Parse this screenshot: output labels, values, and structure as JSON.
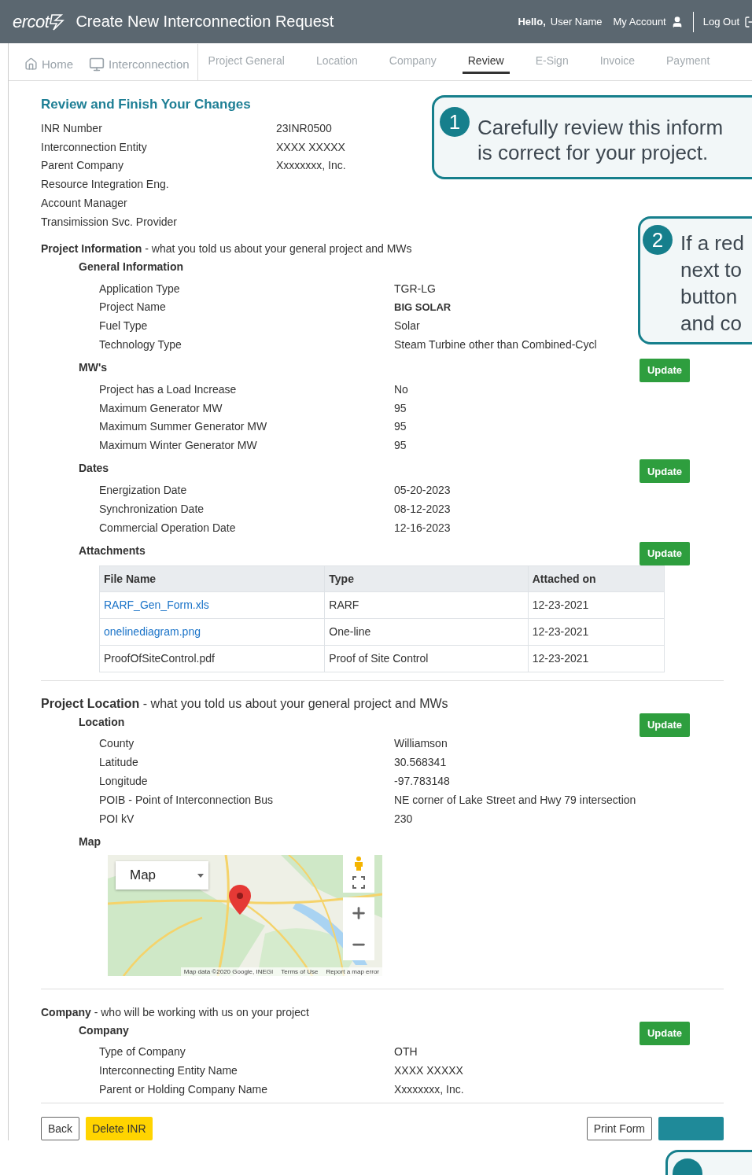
{
  "header": {
    "logo": "ercot",
    "title": "Create New Interconnection Request",
    "greeting": "Hello,",
    "user": "User Name",
    "account": "My Account",
    "logout": "Log Out"
  },
  "nav": {
    "home": "Home",
    "interconnection": "Interconnection",
    "steps": [
      {
        "label": "Project General",
        "selected": false
      },
      {
        "label": "Location",
        "selected": false
      },
      {
        "label": "Company",
        "selected": false
      },
      {
        "label": "Review",
        "selected": true
      },
      {
        "label": "E-Sign",
        "selected": false
      },
      {
        "label": "Invoice",
        "selected": false
      },
      {
        "label": "Payment",
        "selected": false
      }
    ]
  },
  "review_title": "Review and Finish Your Changes",
  "summary": [
    {
      "label": "INR Number",
      "value": "23INR0500"
    },
    {
      "label": "Interconnection Entity",
      "value": "XXXX XXXXX"
    },
    {
      "label": "Parent Company",
      "value": "Xxxxxxxx, Inc."
    },
    {
      "label": "Resource Integration Eng."
    },
    {
      "label": "Account Manager"
    },
    {
      "label": "Transimission Svc. Provider"
    }
  ],
  "sections": [
    {
      "title": "Project Information",
      "subtitle": " - what you told us about your general project and MWs",
      "groups": [
        {
          "kind": "fields",
          "title": "General Information",
          "rows": [
            {
              "label": "Application Type",
              "value": "TGR-LG",
              "bold": false
            },
            {
              "label": "Project Name",
              "value": "BIG SOLAR",
              "bold": true
            },
            {
              "label": "Fuel Type",
              "value": "Solar",
              "bold": false
            },
            {
              "label": "Technology Type",
              "value": "Steam Turbine other than Combined-Cycl",
              "bold": false
            }
          ]
        },
        {
          "kind": "fields",
          "title": "MW's",
          "update": "Update",
          "rows": [
            {
              "label": "Project has a Load Increase",
              "value": "No",
              "bold": false
            },
            {
              "label": "Maximum Generator MW",
              "value": "95",
              "bold": false
            },
            {
              "label": "Maximum Summer Generator MW",
              "value": "95",
              "bold": false
            },
            {
              "label": "Maximum Winter Generator MW",
              "value": "95",
              "bold": false
            }
          ]
        },
        {
          "kind": "fields",
          "title": "Dates",
          "update": "Update",
          "rows": [
            {
              "label": "Energization Date",
              "value": "05-20-2023",
              "bold": false
            },
            {
              "label": "Synchronization Date",
              "value": "08-12-2023",
              "bold": false
            },
            {
              "label": "Commercial Operation Date",
              "value": "12-16-2023",
              "bold": false
            }
          ]
        },
        {
          "kind": "attachments",
          "title": "Attachments",
          "update": "Update",
          "columns": [
            "File Name",
            "Type",
            "Attached on"
          ],
          "rows": [
            {
              "file": "RARF_Gen_Form.xls",
              "link": true,
              "type": "RARF",
              "date": "12-23-2021"
            },
            {
              "file": "onelinediagram.png",
              "link": true,
              "type": "One-line",
              "date": "12-23-2021"
            },
            {
              "file": "ProofOfSiteControl.pdf",
              "link": false,
              "type": "Proof of Site Control",
              "date": "12-23-2021"
            }
          ]
        }
      ]
    },
    {
      "title": "Project Location",
      "subtitle": " - what you told us about your general project and MWs",
      "groups": [
        {
          "kind": "fields",
          "title": "Location",
          "update": "Update",
          "rows": [
            {
              "label": "County",
              "value": "Williamson",
              "bold": false
            },
            {
              "label": "Latitude",
              "value": "30.568341",
              "bold": false
            },
            {
              "label": "Longitude",
              "value": "-97.783148",
              "bold": false
            },
            {
              "label": "POIB - Point of Interconnection Bus",
              "value": "NE corner of Lake Street and Hwy 79 intersection",
              "bold": false
            },
            {
              "label": "POI kV",
              "value": "230",
              "bold": false
            }
          ]
        },
        {
          "kind": "map",
          "title": "Map",
          "map_type": "Map",
          "attribution": [
            "Map data ©2020 Google, INEGI",
            "Terms of Use",
            "Report a map error"
          ]
        }
      ]
    },
    {
      "title": "Company",
      "subtitle": " - who will be working with us on your project",
      "groups": [
        {
          "kind": "fields",
          "title": "Company",
          "update": "Update",
          "rows": [
            {
              "label": "Type of Company",
              "value": "OTH",
              "bold": false
            },
            {
              "label": "Interconnecting Entity Name",
              "value": "XXXX XXXXX",
              "bold": false
            },
            {
              "label": "Parent or Holding Company Name",
              "value": "Xxxxxxxx, Inc.",
              "bold": false
            }
          ]
        }
      ]
    }
  ],
  "footer": {
    "back": "Back",
    "delete": "Delete INR",
    "print": "Print Form"
  },
  "callouts": [
    {
      "number": "1",
      "lines": [
        "Carefully review this inform",
        "is correct for your project."
      ]
    },
    {
      "number": "2",
      "lines": [
        "If a red",
        "next to",
        "button",
        "and co"
      ]
    }
  ]
}
